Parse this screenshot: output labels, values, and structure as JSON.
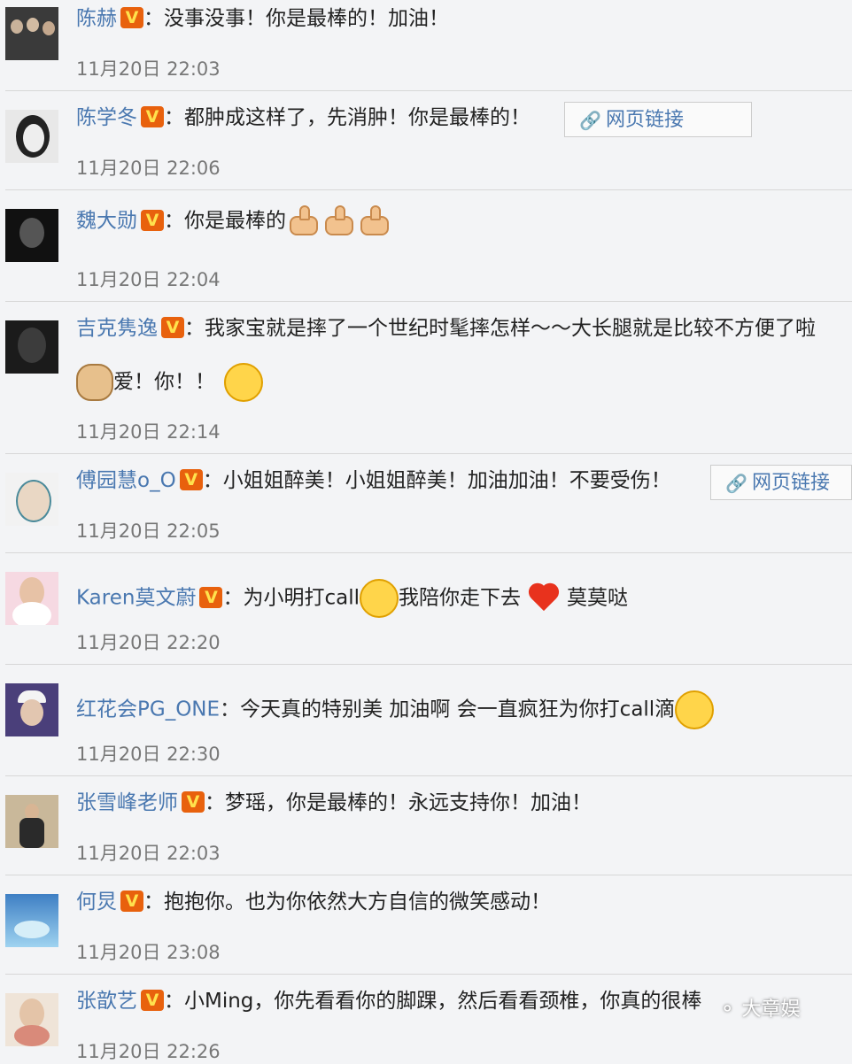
{
  "verified_badge": "V",
  "separator": "：",
  "link_label": "网页链接",
  "comments": [
    {
      "user": "陈赫",
      "text": "没事没事！你是最棒的！加油！",
      "time": "11月20日 22:03"
    },
    {
      "user": "陈学冬",
      "text": "都肿成这样了，先消肿！你是最棒的！",
      "time": "11月20日 22:06"
    },
    {
      "user": "魏大勋",
      "text": "你是最棒的",
      "time": "11月20日 22:04"
    },
    {
      "user": "吉克隽逸",
      "text": "我家宝就是摔了一个世纪时髦摔怎样～～大长腿就是比较不方便了啦",
      "text2": "爱！你！！",
      "time": "11月20日 22:14"
    },
    {
      "user": "傅园慧o_O",
      "text": "小姐姐醉美！小姐姐醉美！加油加油！不要受伤！",
      "time": "11月20日 22:05"
    },
    {
      "user": "Karen莫文蔚",
      "text": "为小明打call",
      "text_b": "我陪你走下去",
      "text_c": "莫莫哒",
      "time": "11月20日 22:20"
    },
    {
      "user": "红花会PG_ONE",
      "text": "今天真的特别美 加油啊 会一直疯狂为你打call滴",
      "time": "11月20日 22:30"
    },
    {
      "user": "张雪峰老师",
      "text": "梦瑶，你是最棒的！永远支持你！加油！",
      "time": "11月20日 22:03"
    },
    {
      "user": "何炅",
      "text": "抱抱你。也为你依然大方自信的微笑感动！",
      "time": "11月20日 23:08"
    },
    {
      "user": "张歆艺",
      "text": "小Ming，你先看看你的脚踝，然后看看颈椎，你真的很棒",
      "time": "11月20日 22:26"
    }
  ],
  "watermark": "大章娱"
}
